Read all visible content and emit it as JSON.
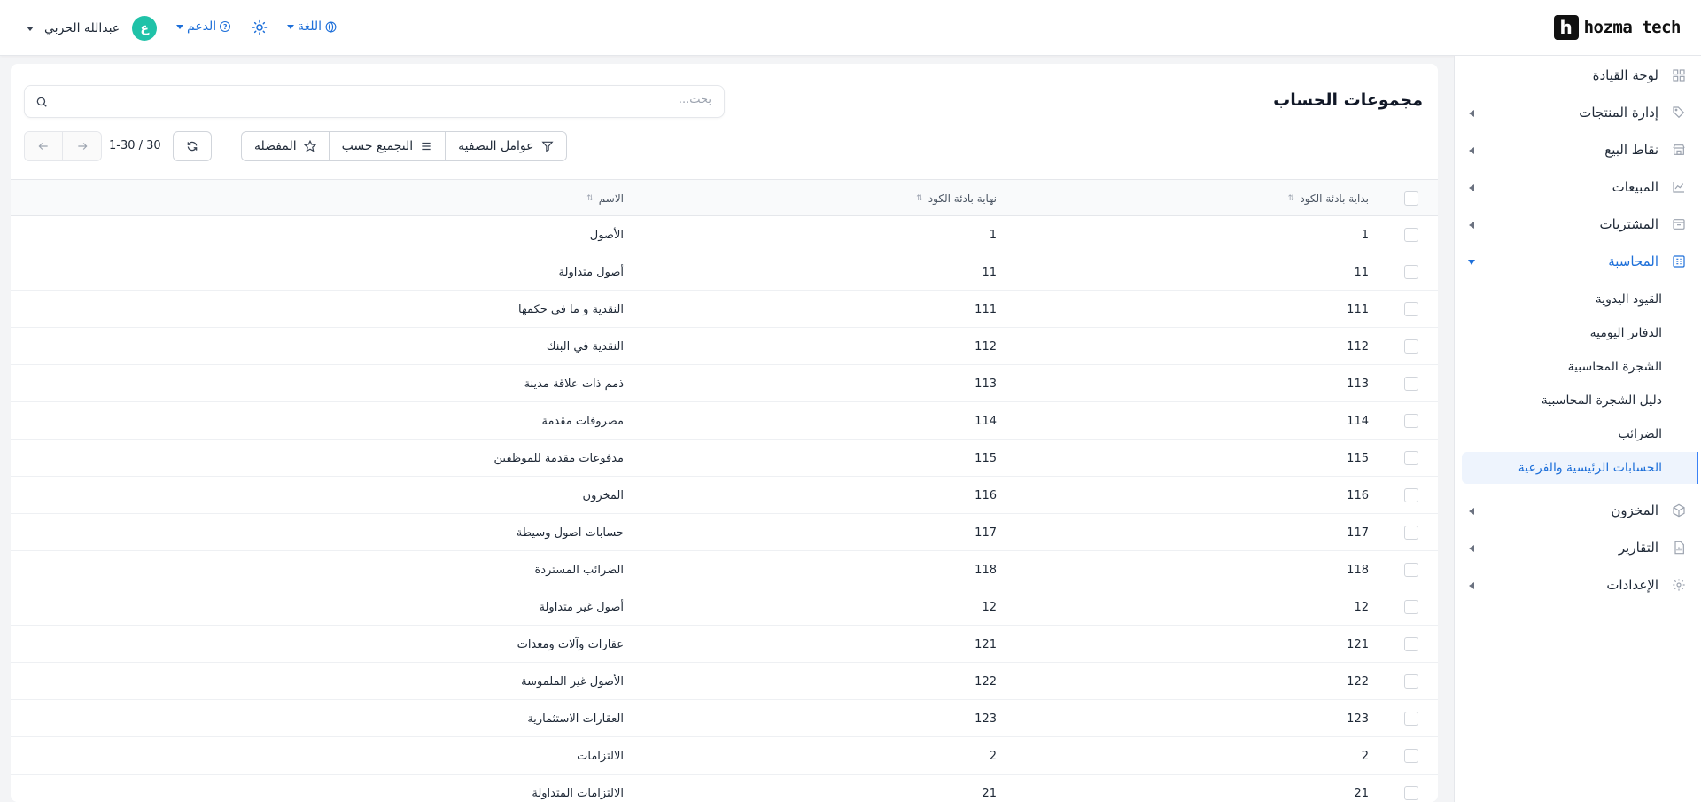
{
  "brand": {
    "logo_letter": "h",
    "logo_text": "hozma tech"
  },
  "header": {
    "user_name": "عبدالله الحربي",
    "avatar_initial": "ع",
    "support_label": "الدعم",
    "language_label": "اللغة"
  },
  "sidebar": {
    "items": [
      {
        "label": "لوحة القيادة",
        "icon": "dashboard-icon"
      },
      {
        "label": "إدارة المنتجات",
        "icon": "tag-icon"
      },
      {
        "label": "نقاط البيع",
        "icon": "store-icon"
      },
      {
        "label": "المبيعات",
        "icon": "chart-icon"
      },
      {
        "label": "المشتريات",
        "icon": "box-icon"
      },
      {
        "label": "المحاسبة",
        "icon": "accounting-icon"
      },
      {
        "label": "المخزون",
        "icon": "cube-icon"
      },
      {
        "label": "التقارير",
        "icon": "report-icon"
      },
      {
        "label": "الإعدادات",
        "icon": "gear-icon"
      }
    ],
    "accounting_sub": [
      "القيود اليدوية",
      "الدفاتر اليومية",
      "الشجرة المحاسبية",
      "دليل الشجرة المحاسبية",
      "الضرائب",
      "الحسابات الرئيسية والفرعية"
    ]
  },
  "main": {
    "title": "مجموعات الحساب",
    "search_placeholder": "بحث...",
    "filters_label": "عوامل التصفية",
    "group_by_label": "التجميع حسب",
    "favorites_label": "المفضلة",
    "pager": "1-30 / 30"
  },
  "table": {
    "headers": {
      "start": "بداية بادئة الكود",
      "end": "نهاية بادئة الكود",
      "name": "الاسم",
      "sort_glyph": "⇅"
    },
    "rows": [
      {
        "start": "1",
        "end": "1",
        "name": "الأصول"
      },
      {
        "start": "11",
        "end": "11",
        "name": "أصول متداولة"
      },
      {
        "start": "111",
        "end": "111",
        "name": "النقدية و ما في حكمها"
      },
      {
        "start": "112",
        "end": "112",
        "name": "النقدية في البنك"
      },
      {
        "start": "113",
        "end": "113",
        "name": "ذمم ذات علاقة مدينة"
      },
      {
        "start": "114",
        "end": "114",
        "name": "مصروفات مقدمة"
      },
      {
        "start": "115",
        "end": "115",
        "name": "مدفوعات مقدمة للموظفين"
      },
      {
        "start": "116",
        "end": "116",
        "name": "المخزون"
      },
      {
        "start": "117",
        "end": "117",
        "name": "حسابات اصول وسيطة"
      },
      {
        "start": "118",
        "end": "118",
        "name": "الضرائب المستردة"
      },
      {
        "start": "12",
        "end": "12",
        "name": "أصول غير متداولة"
      },
      {
        "start": "121",
        "end": "121",
        "name": "عقارات وآلات ومعدات"
      },
      {
        "start": "122",
        "end": "122",
        "name": "الأصول غير الملموسة"
      },
      {
        "start": "123",
        "end": "123",
        "name": "العقارات الاستثمارية"
      },
      {
        "start": "2",
        "end": "2",
        "name": "الالتزامات"
      },
      {
        "start": "21",
        "end": "21",
        "name": "الالتزامات المتداولة"
      }
    ]
  }
}
